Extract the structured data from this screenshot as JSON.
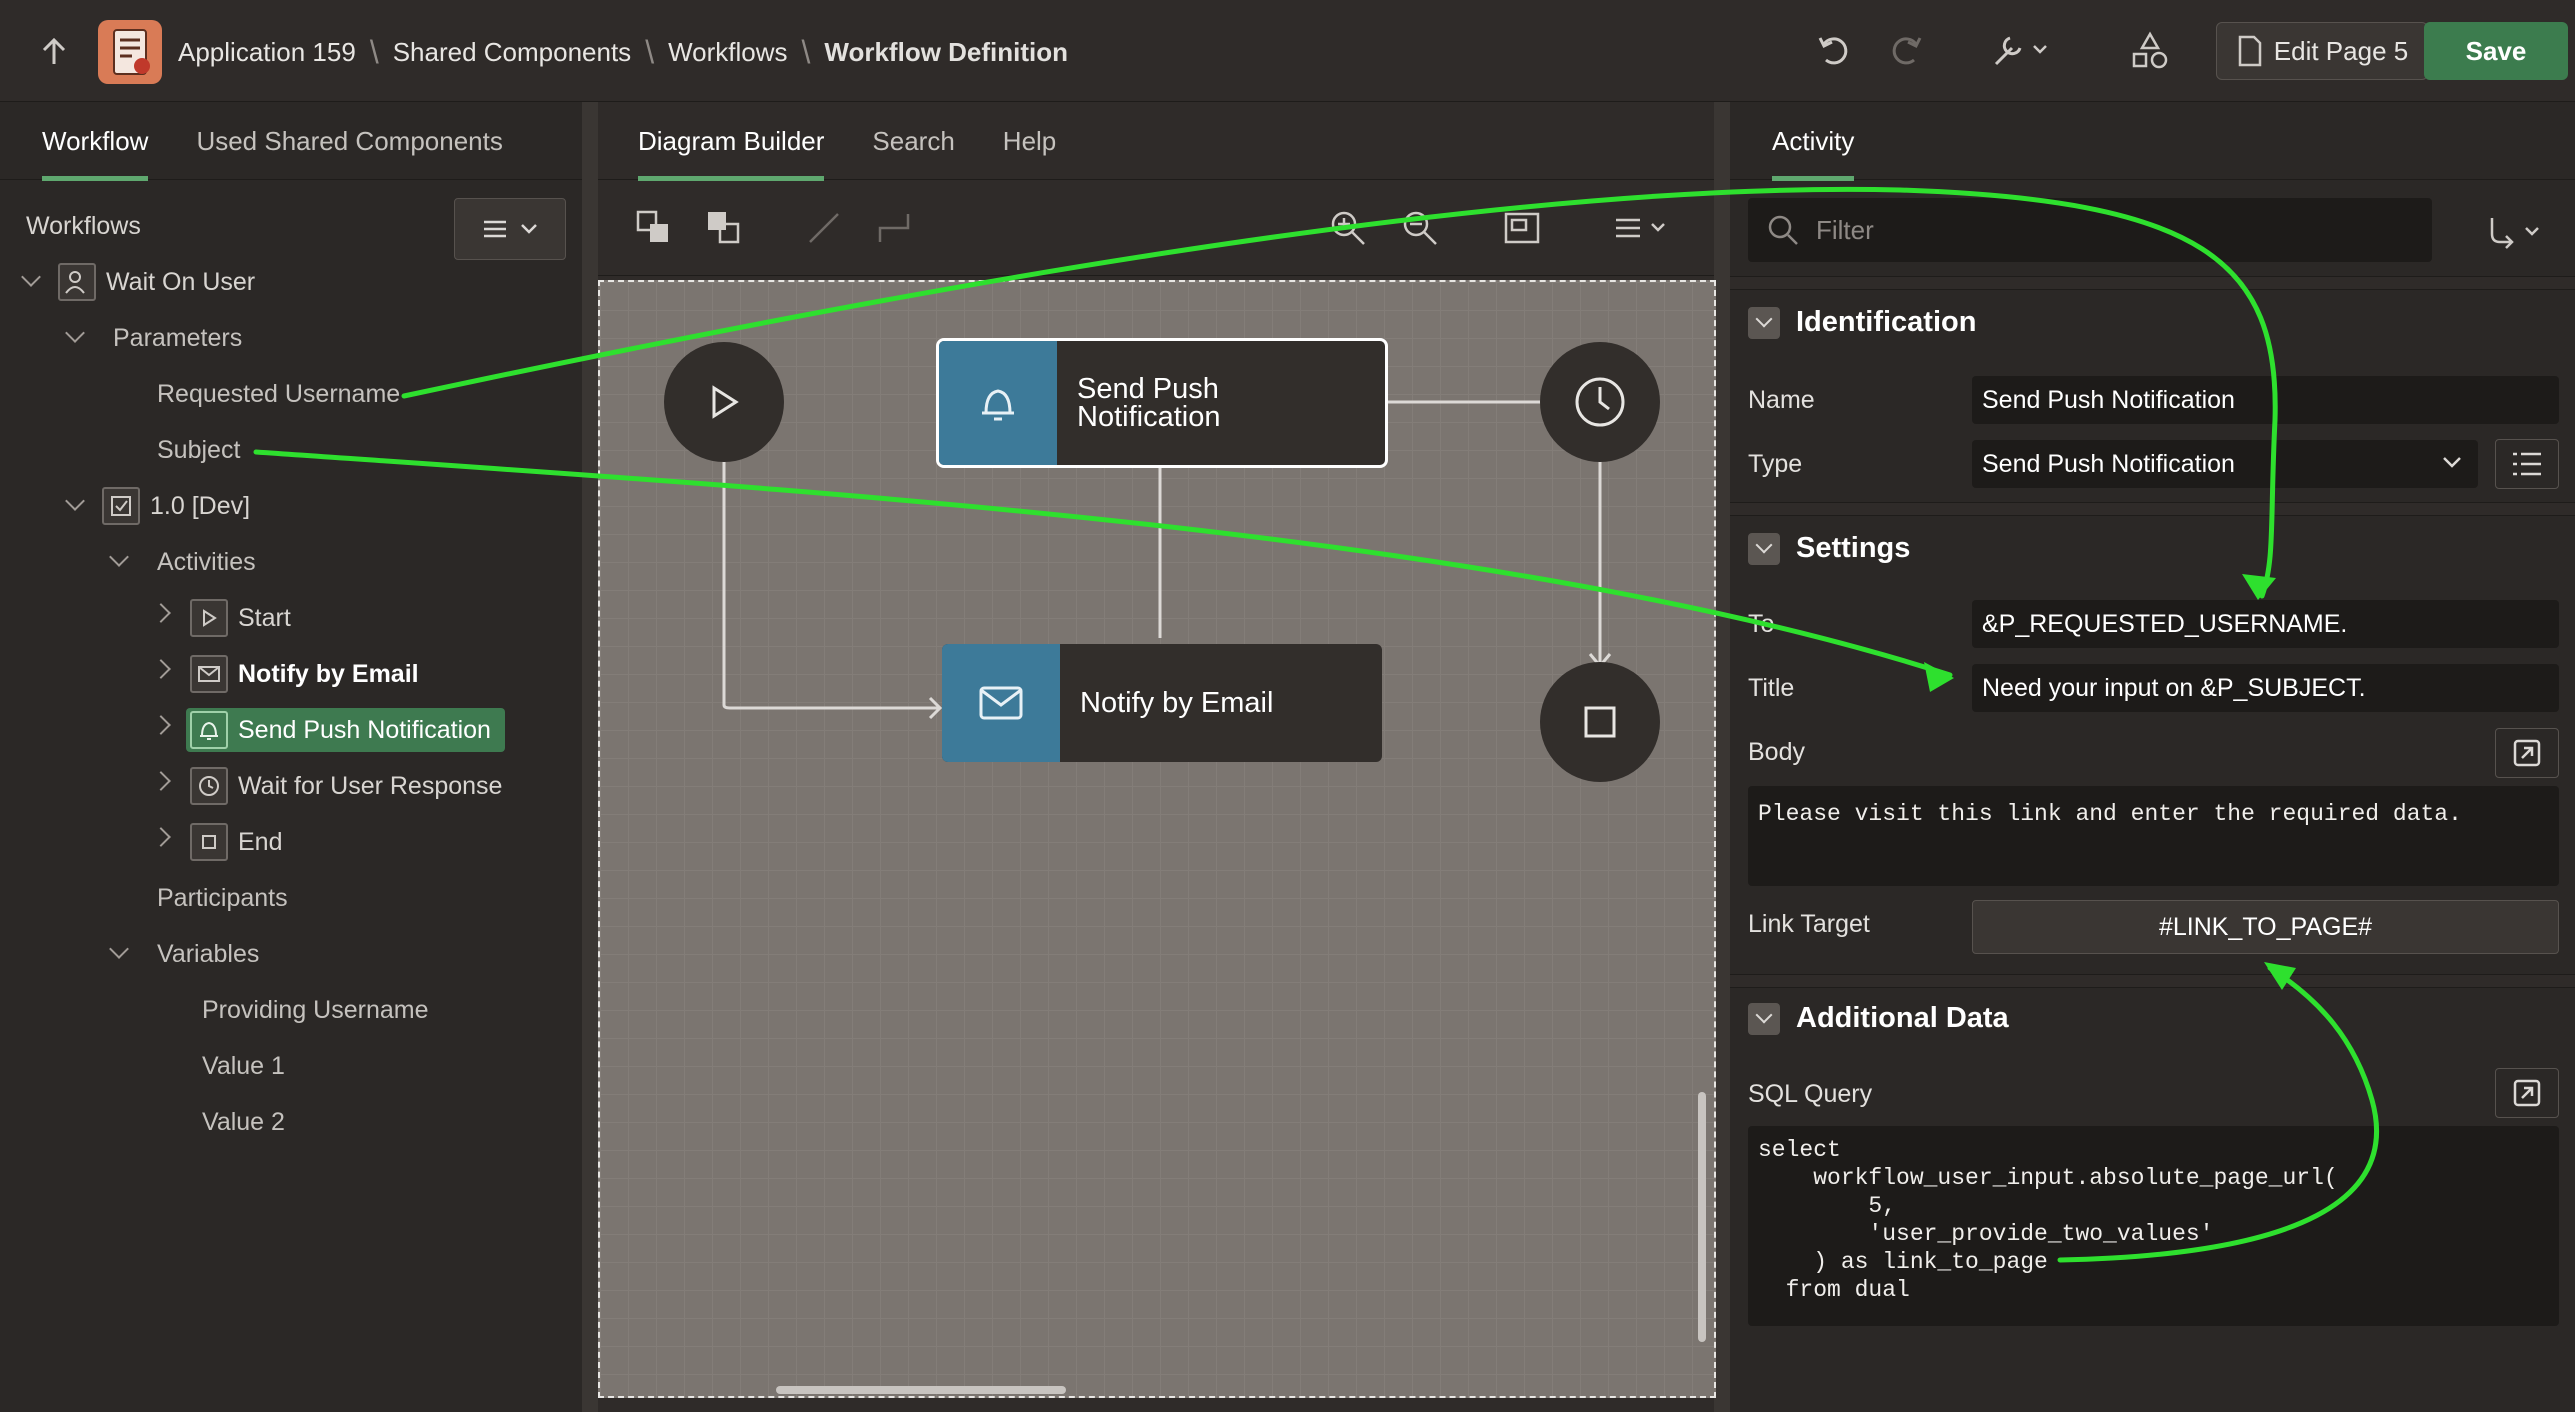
{
  "header": {
    "breadcrumbs": [
      "Application 159",
      "Shared Components",
      "Workflows",
      "Workflow Definition"
    ],
    "edit_page_label": "Edit Page 5",
    "save_label": "Save"
  },
  "left": {
    "tabs": [
      "Workflow",
      "Used Shared Components"
    ],
    "workflows_label": "Workflows",
    "tree": {
      "workflow": "Wait On User",
      "parameters": "Parameters",
      "param_items": [
        "Requested Username",
        "Subject"
      ],
      "version": "1.0 [Dev]",
      "activities": "Activities",
      "activity_items": [
        "Start",
        "Notify by Email",
        "Send Push Notification",
        "Wait for User Response",
        "End"
      ],
      "participants": "Participants",
      "variables": "Variables",
      "variable_items": [
        "Providing Username",
        "Value 1",
        "Value 2"
      ]
    }
  },
  "center": {
    "tabs": [
      "Diagram Builder",
      "Search",
      "Help"
    ],
    "nodes": {
      "push_line1": "Send Push",
      "push_line2": "Notification",
      "email": "Notify by Email"
    }
  },
  "right": {
    "tab": "Activity",
    "filter_placeholder": "Filter",
    "identification": {
      "heading": "Identification",
      "name_label": "Name",
      "name_value": "Send Push Notification",
      "type_label": "Type",
      "type_value": "Send Push Notification"
    },
    "settings": {
      "heading": "Settings",
      "to_label": "To",
      "to_value": "&P_REQUESTED_USERNAME.",
      "title_label": "Title",
      "title_value": "Need your input on &P_SUBJECT.",
      "body_label": "Body",
      "body_value": "Please visit this link and enter the required data.",
      "link_label": "Link Target",
      "link_value": "#LINK_TO_PAGE#"
    },
    "additional": {
      "heading": "Additional Data",
      "sql_label": "SQL Query",
      "sql_lines": [
        "select",
        "    workflow_user_input.absolute_page_url(",
        "        5,",
        "        'user_provide_two_values'",
        "    ) as link_to_page",
        "  from dual"
      ]
    }
  },
  "colors": {
    "accent_green": "#3c7c4e",
    "annotation_green": "#2ee02e",
    "node_blue": "#3d7a99"
  }
}
